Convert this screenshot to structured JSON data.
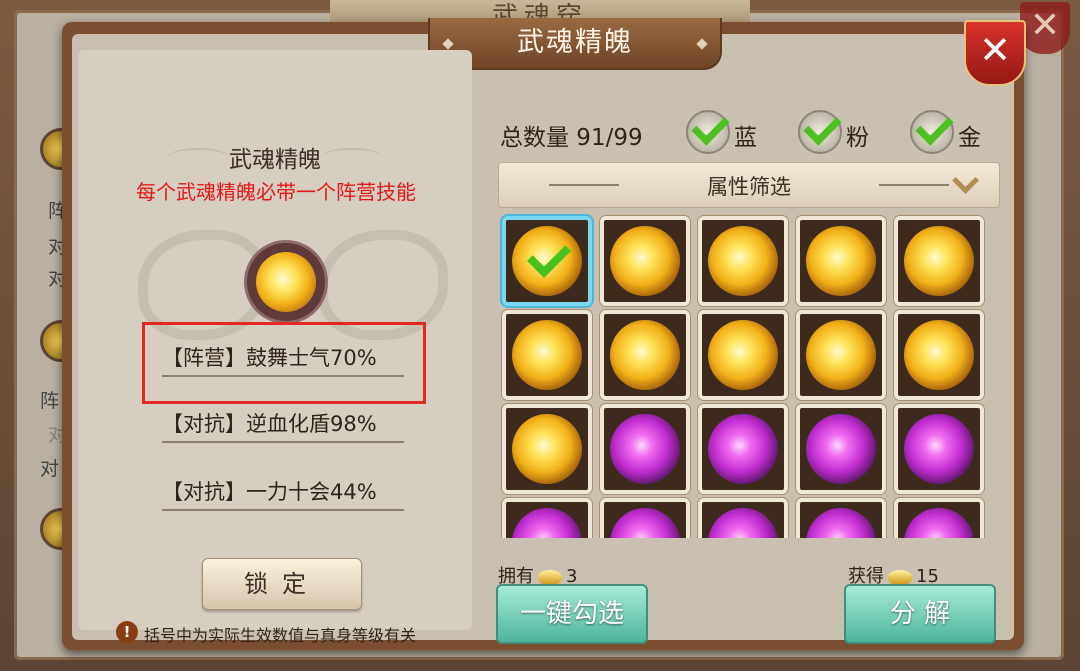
{
  "background": {
    "title": "武魂窍",
    "close_glyph": "✕",
    "left_fragments": [
      "阵",
      "对",
      "对",
      "阵",
      "对",
      "对"
    ]
  },
  "dialog": {
    "title": "武魂精魄",
    "close_glyph": "✕"
  },
  "left": {
    "title": "武魂精魄",
    "note": "每个武魂精魄必带一个阵营技能",
    "attributes": [
      "【阵营】鼓舞士气70%",
      "【对抗】逆血化盾98%",
      "【对抗】一力十会44%"
    ],
    "lock_button": "锁定",
    "info_glyph": "!",
    "info_text": "括号中为实际生效数值与真身等级有关"
  },
  "right": {
    "count_label": "总数量 91/99",
    "filters": [
      {
        "label": "蓝",
        "checked": true
      },
      {
        "label": "粉",
        "checked": true
      },
      {
        "label": "金",
        "checked": true
      }
    ],
    "filter_bar_label": "属性筛选",
    "grid_items": [
      {
        "type": "gold",
        "selected": true
      },
      {
        "type": "gold",
        "selected": false
      },
      {
        "type": "gold",
        "selected": false
      },
      {
        "type": "gold",
        "selected": false
      },
      {
        "type": "gold",
        "selected": false
      },
      {
        "type": "gold",
        "selected": false
      },
      {
        "type": "gold",
        "selected": false
      },
      {
        "type": "gold",
        "selected": false
      },
      {
        "type": "gold",
        "selected": false
      },
      {
        "type": "gold",
        "selected": false
      },
      {
        "type": "gold",
        "selected": false
      },
      {
        "type": "purple",
        "selected": false
      },
      {
        "type": "purple",
        "selected": false
      },
      {
        "type": "purple",
        "selected": false
      },
      {
        "type": "purple",
        "selected": false
      },
      {
        "type": "purple",
        "selected": false
      },
      {
        "type": "purple",
        "selected": false
      },
      {
        "type": "purple",
        "selected": false
      },
      {
        "type": "purple",
        "selected": false
      },
      {
        "type": "purple",
        "selected": false
      }
    ],
    "owned_label": "拥有",
    "owned_value": "3",
    "gain_label": "获得",
    "gain_value": "15",
    "select_all_button": "一键勾选",
    "decompose_button": "分 解"
  }
}
